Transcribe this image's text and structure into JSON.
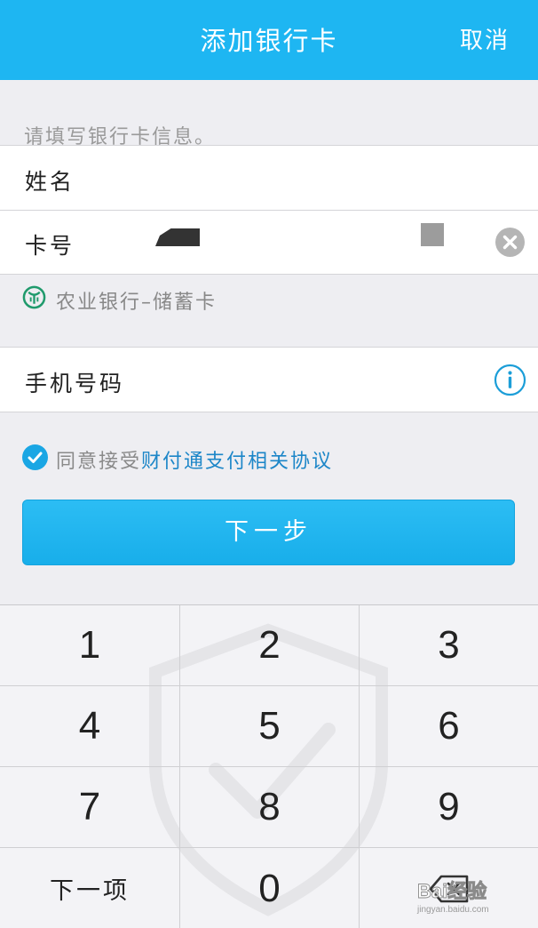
{
  "header": {
    "title": "添加银行卡",
    "cancel_label": "取消"
  },
  "form": {
    "hint": "请填写银行卡信息。",
    "name_label": "姓名",
    "card_label": "卡号",
    "phone_label": "手机号码"
  },
  "bank": {
    "name": "农业银行–储蓄卡",
    "icon": "abc-bank-logo-icon",
    "color": "#1f9a6c"
  },
  "agreement": {
    "prefix": "同意接受",
    "link": "财付通支付相关协议",
    "checked": true
  },
  "next_button": {
    "label": "下一步"
  },
  "keypad": {
    "keys": [
      "1",
      "2",
      "3",
      "4",
      "5",
      "6",
      "7",
      "8",
      "9",
      "下一项",
      "0",
      "⌫"
    ]
  },
  "watermark": {
    "text": "Bai经验",
    "subtext": "jingyan.baidu.com"
  },
  "colors": {
    "accent": "#1eb6f2",
    "link": "#1c86c8",
    "background": "#eeeef2"
  }
}
